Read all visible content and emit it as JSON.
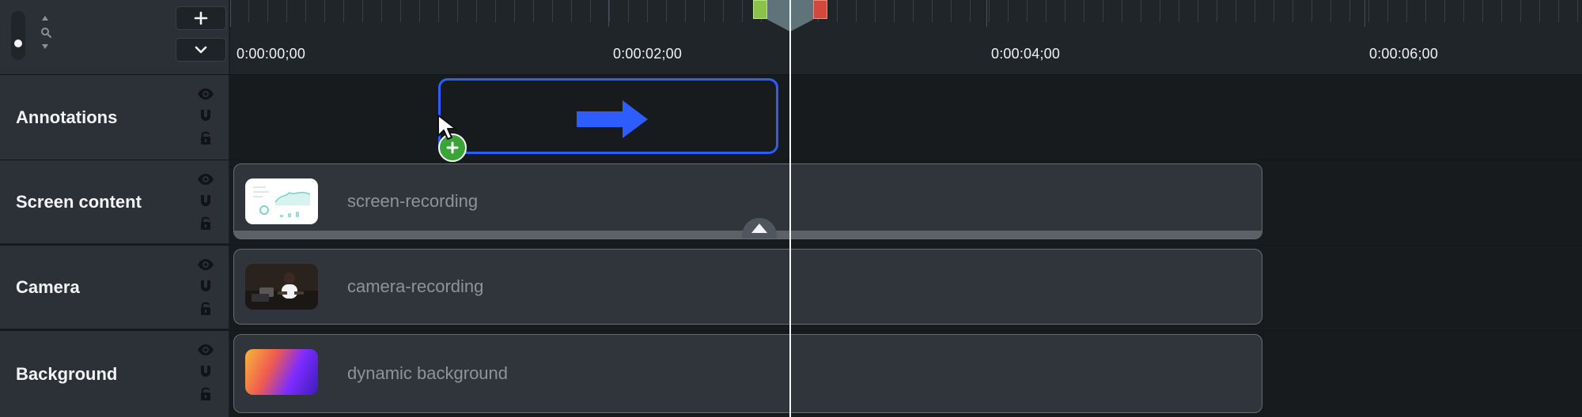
{
  "timeline": {
    "ruler_labels": [
      "0:00:00;00",
      "0:00:02;00",
      "0:00:04;00",
      "0:00:06;00"
    ],
    "header_controls": {
      "zoom_icon": "zoom-icon",
      "add_icon": "plus-icon",
      "collapse_icon": "chevron-down-icon"
    },
    "tracks": [
      {
        "name": "Annotations",
        "icons": [
          "eye-icon",
          "magnet-icon",
          "unlock-icon"
        ],
        "clip": {
          "type": "annotation",
          "icon": "arrow-right-icon",
          "accent_color": "#2d5cff"
        }
      },
      {
        "name": "Screen content",
        "icons": [
          "eye-icon",
          "magnet-icon",
          "unlock-icon"
        ],
        "clip": {
          "label": "screen-recording",
          "thumbnail_icon": "dashboard-thumbnail-icon",
          "expand_icon": "chevron-up-icon"
        }
      },
      {
        "name": "Camera",
        "icons": [
          "eye-icon",
          "magnet-icon",
          "unlock-icon"
        ],
        "clip": {
          "label": "camera-recording",
          "thumbnail_icon": "person-thumbnail-icon"
        }
      },
      {
        "name": "Background",
        "icons": [
          "eye-icon",
          "magnet-icon",
          "unlock-icon"
        ],
        "clip": {
          "label": "dynamic background",
          "thumbnail_icon": "gradient-thumbnail-icon"
        }
      }
    ],
    "overlay": {
      "add_badge_icon": "plus-circle-icon",
      "cursor_icon": "cursor-arrow-icon"
    },
    "colors": {
      "panel": "#2b3137",
      "timeline": "#171b1e",
      "clip": "#2f353b",
      "annotation": "#2d5cff",
      "playhead_green": "#8bc34a",
      "playhead_red": "#cf4a3c"
    }
  }
}
